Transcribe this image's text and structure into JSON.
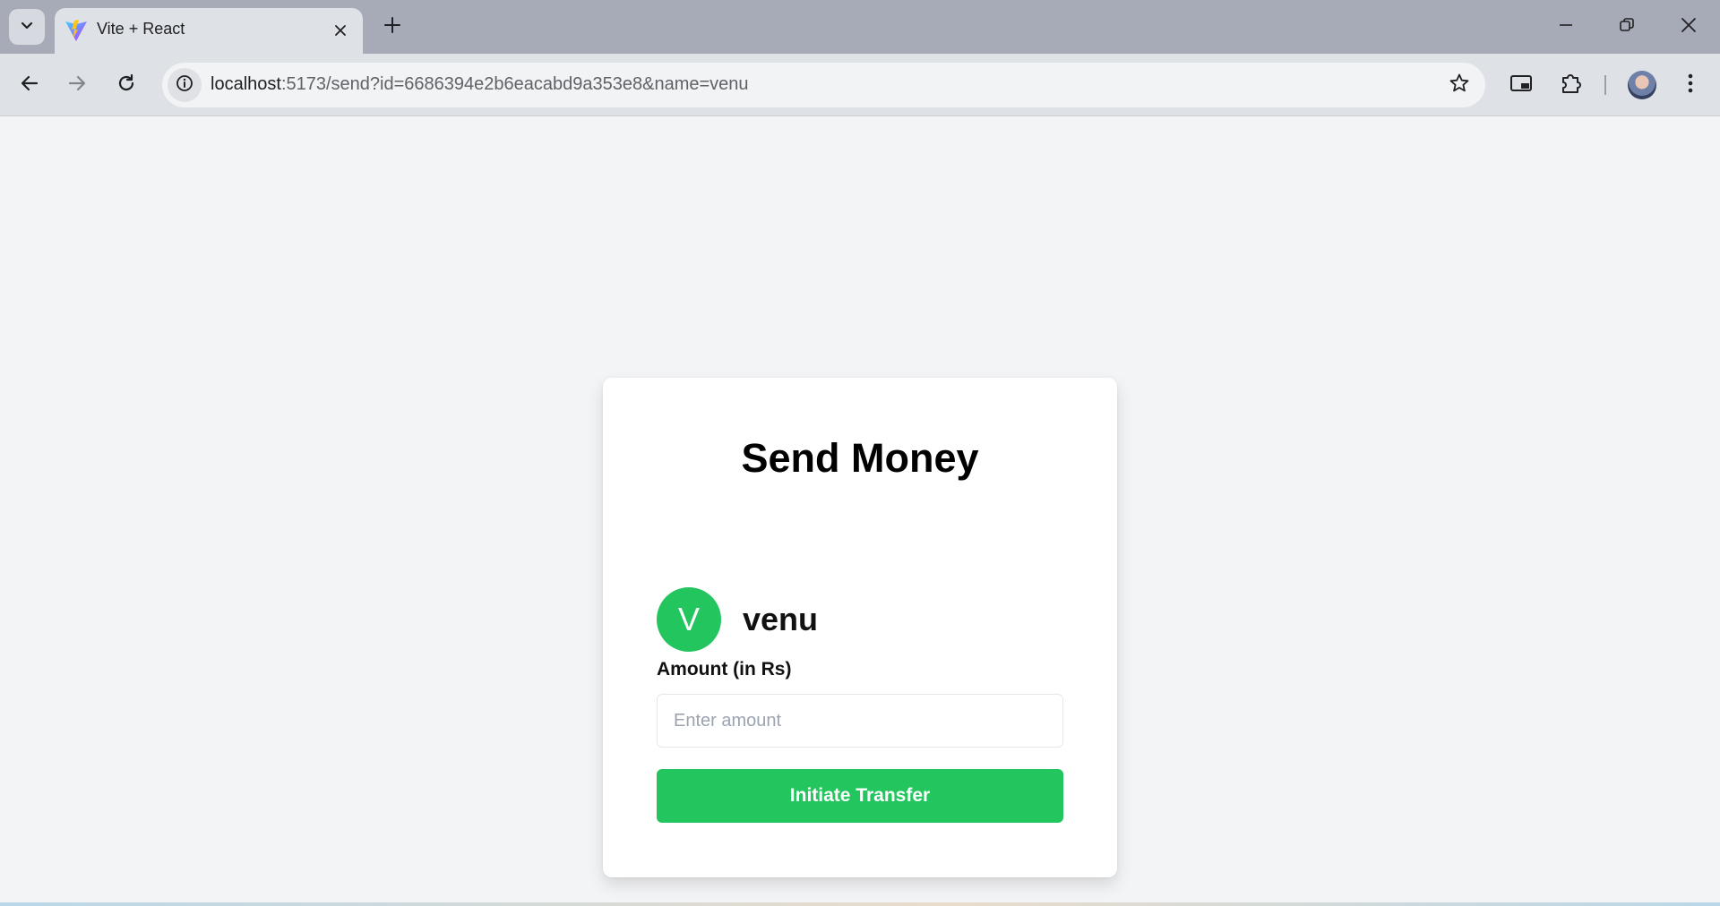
{
  "browser": {
    "tab_title": "Vite + React",
    "url_host": "localhost",
    "url_rest": ":5173/send?id=6686394e2b6eacabd9a353e8&name=venu"
  },
  "icons": {
    "tab_search": "chevron-down-icon",
    "favicon": "vite-logo-icon",
    "tab_close": "close-icon",
    "new_tab": "plus-icon",
    "minimize": "minimize-icon",
    "restore": "restore-icon",
    "close_window": "close-icon",
    "back": "arrow-left-icon",
    "forward": "arrow-right-icon",
    "reload": "reload-icon",
    "site_info": "info-icon",
    "bookmark": "star-icon",
    "picture_in_picture": "pip-icon",
    "extensions": "puzzle-icon",
    "profile": "avatar-icon",
    "menu": "kebab-menu-icon"
  },
  "page": {
    "title": "Send Money",
    "recipient": {
      "initial": "V",
      "name": "venu"
    },
    "amount_label": "Amount (in Rs)",
    "amount_placeholder": "Enter amount",
    "amount_value": "",
    "submit_label": "Initiate Transfer"
  },
  "colors": {
    "accent_green": "#22c55e",
    "page_background": "#f3f4f6",
    "card_background": "#ffffff"
  }
}
